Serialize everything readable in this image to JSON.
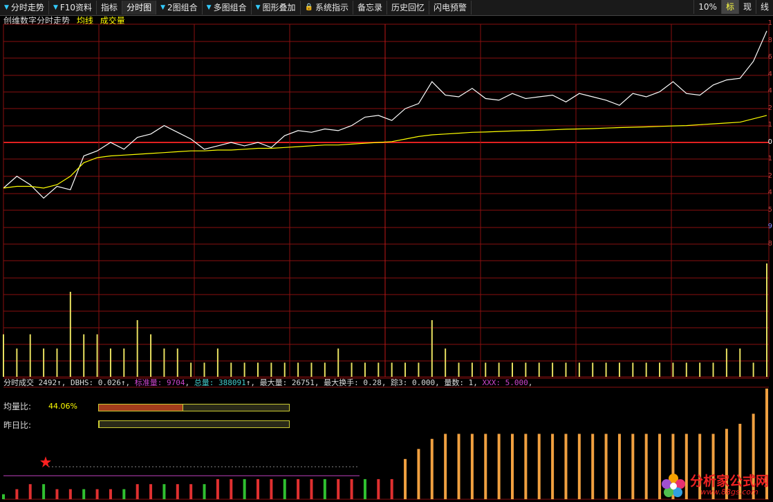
{
  "toolbar": {
    "items": [
      {
        "label": "分时走势",
        "dropdown": true
      },
      {
        "label": "F10资料",
        "dropdown": true
      },
      {
        "label": "指标",
        "dropdown": false
      },
      {
        "label": "分时图",
        "dropdown": false,
        "active": true
      },
      {
        "label": "2图组合",
        "dropdown": true
      },
      {
        "label": "多图组合",
        "dropdown": true
      },
      {
        "label": "图形叠加",
        "dropdown": true
      },
      {
        "label": "系统指示",
        "lock": true
      },
      {
        "label": "备忘录"
      },
      {
        "label": "历史回忆"
      },
      {
        "label": "闪电预警"
      }
    ],
    "right": [
      {
        "label": "10%"
      },
      {
        "label": "标",
        "selected": true
      },
      {
        "label": "现"
      },
      {
        "label": "线"
      }
    ]
  },
  "legend": {
    "title": "创维数字分时走势",
    "avg_label": "均线",
    "vol_label": "成交量",
    "colors": {
      "title": "#dddddd",
      "avg": "#ffff00",
      "vol": "#ffff00"
    }
  },
  "status": [
    {
      "text": "分时成交 2492",
      "color": "#dddddd"
    },
    {
      "text": "↑, DBHS: 0.026",
      "color": "#dddddd"
    },
    {
      "text": "↑, ",
      "color": "#dddddd"
    },
    {
      "text": "标准量: 9704",
      "color": "#cc44cc"
    },
    {
      "text": ", ",
      "color": "#dddddd"
    },
    {
      "text": "总量: 388091",
      "color": "#44cccc"
    },
    {
      "text": "↑, 最大量: 26751, 最大换手: 0.28, 踪3: 0.000, 量数: 1, ",
      "color": "#dddddd"
    },
    {
      "text": "XXX: 5.000",
      "color": "#cc44cc"
    },
    {
      "text": ",",
      "color": "#dddddd"
    }
  ],
  "indicators": {
    "junliang_label": "均量比:",
    "junliang_value": "44.06%",
    "junliang_fraction": 0.4406,
    "zuori_label": "昨日比:",
    "zuori_fraction": 0
  },
  "right_axis_digits": [
    "1",
    "8",
    "6",
    "4",
    "4",
    "2",
    "1",
    "0",
    "1",
    "2",
    "4",
    "5",
    "9",
    "8"
  ],
  "watermark": {
    "name": "分析家公式网",
    "url": "www.88gs.com"
  },
  "chart_data": {
    "type": "line",
    "title": "创维数字分时走势",
    "series": [
      {
        "name": "分时走势",
        "color": "#ffffff",
        "values": [
          0.3,
          1.0,
          0.5,
          -0.3,
          0.4,
          0.2,
          2.2,
          2.5,
          3.0,
          2.6,
          3.3,
          3.5,
          4.0,
          3.6,
          3.2,
          2.6,
          2.8,
          3.0,
          2.8,
          3.0,
          2.7,
          3.4,
          3.7,
          3.6,
          3.8,
          3.7,
          4.0,
          4.5,
          4.6,
          4.3,
          5.0,
          5.3,
          6.6,
          5.8,
          5.7,
          6.2,
          5.6,
          5.5,
          5.9,
          5.6,
          5.7,
          5.8,
          5.4,
          5.9,
          5.7,
          5.5,
          5.2,
          5.9,
          5.7,
          6.0,
          6.6,
          5.9,
          5.8,
          6.4,
          6.7,
          6.8,
          7.8,
          9.6
        ]
      },
      {
        "name": "均线",
        "color": "#ffff00",
        "values": [
          0.3,
          0.4,
          0.4,
          0.3,
          0.5,
          1.0,
          1.8,
          2.1,
          2.2,
          2.25,
          2.3,
          2.35,
          2.4,
          2.45,
          2.5,
          2.5,
          2.55,
          2.55,
          2.6,
          2.65,
          2.65,
          2.7,
          2.75,
          2.8,
          2.85,
          2.85,
          2.9,
          2.95,
          3.0,
          3.05,
          3.2,
          3.35,
          3.45,
          3.5,
          3.55,
          3.6,
          3.62,
          3.65,
          3.68,
          3.7,
          3.72,
          3.75,
          3.78,
          3.8,
          3.82,
          3.85,
          3.88,
          3.9,
          3.92,
          3.95,
          3.98,
          4.0,
          4.05,
          4.1,
          4.15,
          4.2,
          4.4,
          4.6
        ]
      }
    ],
    "volume": [
      3,
      2,
      3,
      2,
      2,
      6,
      3,
      3,
      2,
      2,
      4,
      3,
      2,
      2,
      1,
      1,
      2,
      1,
      1,
      1,
      1,
      1,
      1,
      1,
      1,
      2,
      1,
      1,
      1,
      1,
      1,
      1,
      4,
      2,
      1,
      1,
      1,
      1,
      1,
      1,
      1,
      1,
      1,
      1,
      1,
      1,
      1,
      1,
      1,
      1,
      1,
      1,
      1,
      1,
      2,
      2,
      1,
      8
    ],
    "ratio": [
      1,
      2,
      3,
      3,
      2,
      2,
      2,
      2,
      2,
      2,
      3,
      3,
      3,
      3,
      3,
      3,
      4,
      4,
      4,
      4,
      4,
      4,
      4,
      4,
      4,
      4,
      4,
      4,
      4,
      4,
      8,
      10,
      12,
      13,
      13,
      13,
      13,
      13,
      13,
      13,
      13,
      13,
      13,
      13,
      13,
      13,
      13,
      13,
      13,
      13,
      13,
      13,
      13,
      13,
      14,
      15,
      17,
      22
    ],
    "ylim": [
      -4,
      10
    ],
    "grid": true
  }
}
